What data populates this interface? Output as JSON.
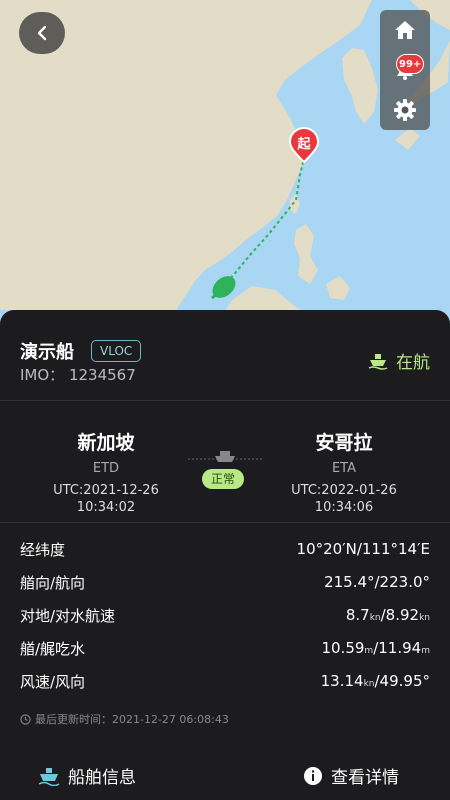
{
  "map": {
    "start_marker": "起",
    "notification_count": "99+",
    "colors": {
      "sea": "#a9d6f2",
      "land": "#e3dcc6",
      "route": "#2db35a",
      "marker": "#e8383d"
    }
  },
  "ship": {
    "name": "演示船",
    "type": "VLOC",
    "imo": "IMO： 1234567",
    "status": "在航"
  },
  "voyage": {
    "departure": {
      "port": "新加坡",
      "code": "ETD",
      "time_line1": "UTC:2021-12-26",
      "time_line2": "10:34:02"
    },
    "arrival": {
      "port": "安哥拉",
      "code": "ETA",
      "time_line1": "UTC:2022-01-26",
      "time_line2": "10:34:06"
    },
    "state": "正常"
  },
  "details": [
    {
      "label": "经纬度",
      "value": "10°20′N/111°14′E"
    },
    {
      "label": "艏向/航向",
      "value": "215.4°/223.0°"
    },
    {
      "label": "对地/对水航速",
      "v1": "8.7",
      "u1": "kn",
      "sep": "/",
      "v2": "8.92",
      "u2": "kn"
    },
    {
      "label": "艏/艉吃水",
      "v1": "10.59",
      "u1": "m",
      "sep": "/",
      "v2": "11.94",
      "u2": "m"
    },
    {
      "label": "风速/风向",
      "v1": "13.14",
      "u1": "kn",
      "sep": "/",
      "v2": "49.95°"
    }
  ],
  "last_updated": "最后更新时间：2021-12-27 06:08:43",
  "bottom": {
    "ship_info": "船舶信息",
    "view_details": "查看详情"
  },
  "icons": [
    "back-icon",
    "home-icon",
    "bell-icon",
    "gear-icon",
    "ship-icon",
    "info-icon",
    "clock-icon"
  ]
}
